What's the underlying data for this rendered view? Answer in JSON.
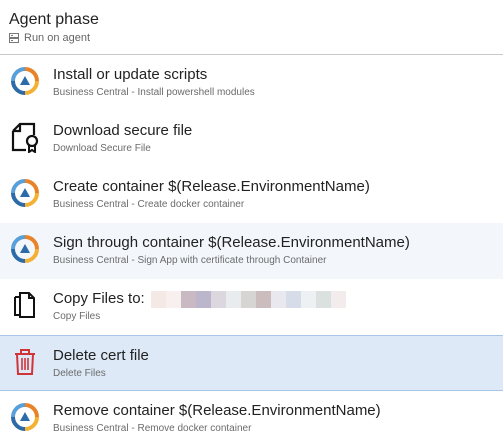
{
  "phase": {
    "title": "Agent phase",
    "subtitle": "Run on agent",
    "icon": "server-icon"
  },
  "tasks": [
    {
      "name": "Install or update scripts",
      "desc": "Business Central - Install powershell modules",
      "icon": "business-central-icon",
      "state": "normal"
    },
    {
      "name": "Download secure file",
      "desc": "Download Secure File",
      "icon": "secure-file-icon",
      "state": "normal"
    },
    {
      "name": "Create container $(Release.EnvironmentName)",
      "desc": "Business Central - Create docker container",
      "icon": "business-central-icon",
      "state": "normal"
    },
    {
      "name": "Sign through container $(Release.EnvironmentName)",
      "desc": "Business Central - Sign App with certificate through Container",
      "icon": "business-central-icon",
      "state": "hover"
    },
    {
      "name": "Copy Files to:",
      "desc": "Copy Files",
      "icon": "copy-files-icon",
      "state": "normal"
    },
    {
      "name": "Delete cert file",
      "desc": "Delete Files",
      "icon": "trash-icon",
      "state": "selected"
    },
    {
      "name": "Remove container $(Release.EnvironmentName)",
      "desc": "Business Central - Remove docker container",
      "icon": "business-central-icon",
      "state": "normal"
    }
  ],
  "colors": {
    "bc_orange": "#e8832a",
    "bc_blue": "#2c6aa8",
    "trash_red": "#d13438",
    "selected_bg": "#dde9f6",
    "hover_bg": "#f3f7fb"
  }
}
